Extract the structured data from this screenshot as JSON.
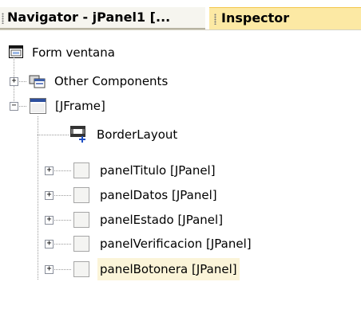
{
  "tabs": [
    {
      "label": "Navigator - jPanel1 [..."
    },
    {
      "label": "Inspector"
    }
  ],
  "tree": {
    "root": {
      "label": "Form ventana",
      "icon": "form-icon"
    },
    "other": {
      "label": "Other Components",
      "icon": "components-icon",
      "expander": "+"
    },
    "frame": {
      "label": "[JFrame]",
      "icon": "frame-icon",
      "expander": "−"
    },
    "layout": {
      "label": "BorderLayout",
      "icon": "border-layout-icon"
    },
    "panels": [
      {
        "label": "panelTitulo [JPanel]",
        "expander": "+"
      },
      {
        "label": "panelDatos [JPanel]",
        "expander": "+"
      },
      {
        "label": "panelEstado [JPanel]",
        "expander": "+"
      },
      {
        "label": "panelVerificacion [JPanel]",
        "expander": "+"
      },
      {
        "label": "panelBotonera [JPanel]",
        "expander": "+"
      }
    ]
  },
  "colors": {
    "active_tab": "#fce9a4",
    "selection": "#fbf4d8"
  }
}
